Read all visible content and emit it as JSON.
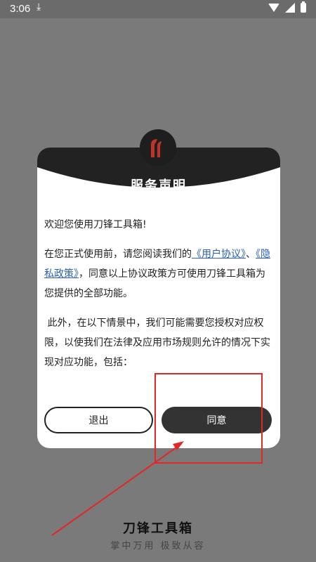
{
  "status_bar": {
    "time": "3:06"
  },
  "dialog": {
    "title": "服务声明",
    "welcome": "欢迎您使用刀锋工具箱!",
    "para1_before": "在您正式使用前，请您阅读我们的",
    "user_agreement_link": "《用户协议》",
    "separator": "、",
    "privacy_link": "《隐私政策》",
    "para1_after": "，同意以上协议政策方可使用刀锋工具箱为您提供的全部功能。",
    "para2": "此外，在以下情景中，我们可能需要您授权对应权限，以使我们在法律及应用市场规则允许的情况下实现对应功能，包括：",
    "exit_label": "退出",
    "agree_label": "同意"
  },
  "footer": {
    "app_name": "刀锋工具箱",
    "slogan": "掌中万用 极致从容"
  }
}
